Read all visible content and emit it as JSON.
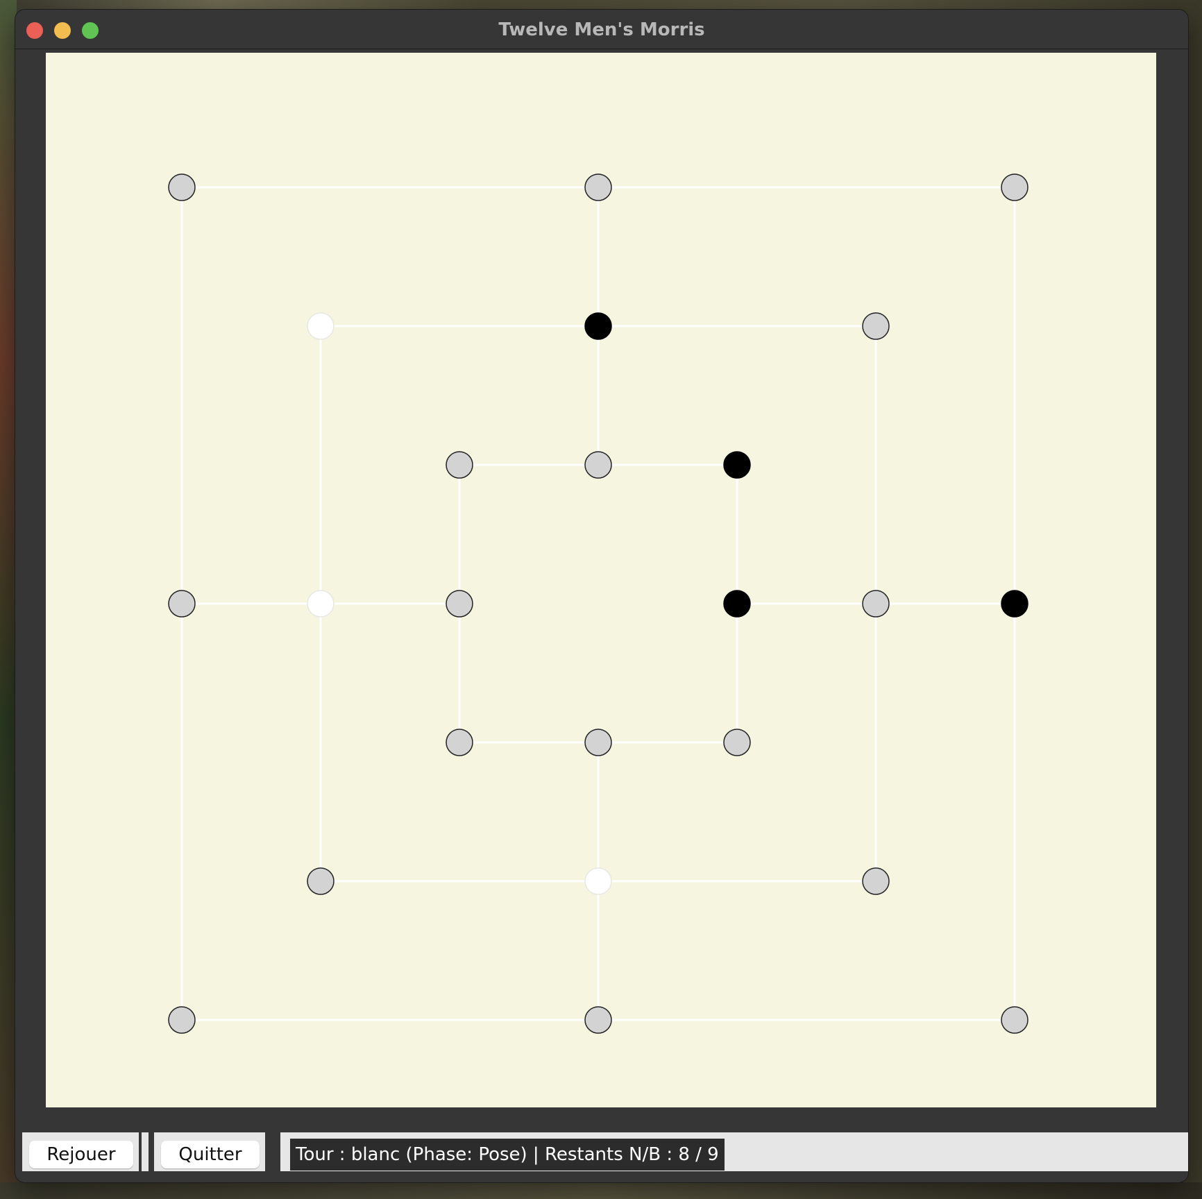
{
  "window": {
    "title": "Twelve Men's Morris"
  },
  "board": {
    "colors": {
      "background": "#f5f5e0",
      "line": "#ffffff",
      "empty_point": "#d3d3d3",
      "white_piece": "#ffffff",
      "black_piece": "#000000"
    },
    "lines": [
      [
        [
          0,
          0
        ],
        [
          6,
          0
        ]
      ],
      [
        [
          6,
          0
        ],
        [
          6,
          6
        ]
      ],
      [
        [
          6,
          6
        ],
        [
          0,
          6
        ]
      ],
      [
        [
          0,
          6
        ],
        [
          0,
          0
        ]
      ],
      [
        [
          1,
          1
        ],
        [
          5,
          1
        ]
      ],
      [
        [
          5,
          1
        ],
        [
          5,
          5
        ]
      ],
      [
        [
          5,
          5
        ],
        [
          1,
          5
        ]
      ],
      [
        [
          1,
          5
        ],
        [
          1,
          1
        ]
      ],
      [
        [
          2,
          2
        ],
        [
          4,
          2
        ]
      ],
      [
        [
          4,
          2
        ],
        [
          4,
          4
        ]
      ],
      [
        [
          4,
          4
        ],
        [
          2,
          4
        ]
      ],
      [
        [
          2,
          4
        ],
        [
          2,
          2
        ]
      ],
      [
        [
          3,
          0
        ],
        [
          3,
          2
        ]
      ],
      [
        [
          3,
          4
        ],
        [
          3,
          6
        ]
      ],
      [
        [
          0,
          3
        ],
        [
          2,
          3
        ]
      ],
      [
        [
          4,
          3
        ],
        [
          6,
          3
        ]
      ]
    ],
    "points": [
      {
        "col": 0,
        "row": 0,
        "state": "empty"
      },
      {
        "col": 3,
        "row": 0,
        "state": "empty"
      },
      {
        "col": 6,
        "row": 0,
        "state": "empty"
      },
      {
        "col": 1,
        "row": 1,
        "state": "white"
      },
      {
        "col": 3,
        "row": 1,
        "state": "black"
      },
      {
        "col": 5,
        "row": 1,
        "state": "empty"
      },
      {
        "col": 2,
        "row": 2,
        "state": "empty"
      },
      {
        "col": 3,
        "row": 2,
        "state": "empty"
      },
      {
        "col": 4,
        "row": 2,
        "state": "black"
      },
      {
        "col": 0,
        "row": 3,
        "state": "empty"
      },
      {
        "col": 1,
        "row": 3,
        "state": "white"
      },
      {
        "col": 2,
        "row": 3,
        "state": "empty"
      },
      {
        "col": 4,
        "row": 3,
        "state": "black"
      },
      {
        "col": 5,
        "row": 3,
        "state": "empty"
      },
      {
        "col": 6,
        "row": 3,
        "state": "black"
      },
      {
        "col": 2,
        "row": 4,
        "state": "empty"
      },
      {
        "col": 3,
        "row": 4,
        "state": "empty"
      },
      {
        "col": 4,
        "row": 4,
        "state": "empty"
      },
      {
        "col": 1,
        "row": 5,
        "state": "empty"
      },
      {
        "col": 3,
        "row": 5,
        "state": "white"
      },
      {
        "col": 5,
        "row": 5,
        "state": "empty"
      },
      {
        "col": 0,
        "row": 6,
        "state": "empty"
      },
      {
        "col": 3,
        "row": 6,
        "state": "empty"
      },
      {
        "col": 6,
        "row": 6,
        "state": "empty"
      }
    ]
  },
  "toolbar": {
    "replay_label": "Rejouer",
    "quit_label": "Quitter",
    "status_text": "Tour : blanc (Phase: Pose) | Restants N/B : 8 / 9"
  }
}
